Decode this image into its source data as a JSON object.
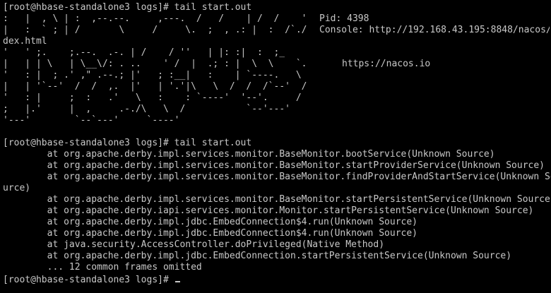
{
  "terminal": {
    "prompt_top": "[root@hbase-standalone3 logs]# tail start.out",
    "ascii_banner": [
      ":   |  , \\ | :  ,--.--.     ,---.  /   /    | /  /    '",
      "|   :  ` ; | /       \\     /     \\.  ;  , .: |  :  /`./",
      "dex.html",
      "'   ' ;.    ;.--.  .-. | /    / ''   | |: :|  :  ;_",
      "|   | | \\   | \\__\\/: . ..    ' /  |  .; : |  \\  \\    `.",
      "'   : |  ; .' ,\" .--.; |'   ; :__|   :    | `----.   \\",
      "|   | '`--'  /  /  ,.  |'   | '.'|\\   \\  /  /  /`--'  /",
      "'   : |     ;  :   .'   \\   :    : `----'  '--'.     /",
      ";   |.'     |  ,     .-./\\   \\  /           `--'---'",
      "'---'        `--`---'     `----'"
    ],
    "banner_info": {
      "pid_label": "Pid: 4398",
      "console_label": "Console: http://192.168.43.195:8848/nacos/",
      "site_label": "https://nacos.io"
    },
    "prompt_second": "[root@hbase-standalone3 logs]# tail start.out",
    "stack_lines": [
      "        at org.apache.derby.impl.services.monitor.BaseMonitor.bootService(Unknown Source)",
      "        at org.apache.derby.impl.services.monitor.BaseMonitor.startProviderService(Unknown Source)",
      "        at org.apache.derby.impl.services.monitor.BaseMonitor.findProviderAndStartService(Unknown So",
      "urce)",
      "        at org.apache.derby.impl.services.monitor.BaseMonitor.startPersistentService(Unknown Source)",
      "        at org.apache.derby.iapi.services.monitor.Monitor.startPersistentService(Unknown Source)",
      "        at org.apache.derby.impl.jdbc.EmbedConnection$4.run(Unknown Source)",
      "        at org.apache.derby.impl.jdbc.EmbedConnection$4.run(Unknown Source)",
      "        at java.security.AccessController.doPrivileged(Native Method)",
      "        at org.apache.derby.impl.jdbc.EmbedConnection.startPersistentService(Unknown Source)",
      "        ... 12 common frames omitted"
    ],
    "prompt_current": "[root@hbase-standalone3 logs]# "
  },
  "colors": {
    "background": "#000000",
    "foreground": "#c8c8c8"
  }
}
